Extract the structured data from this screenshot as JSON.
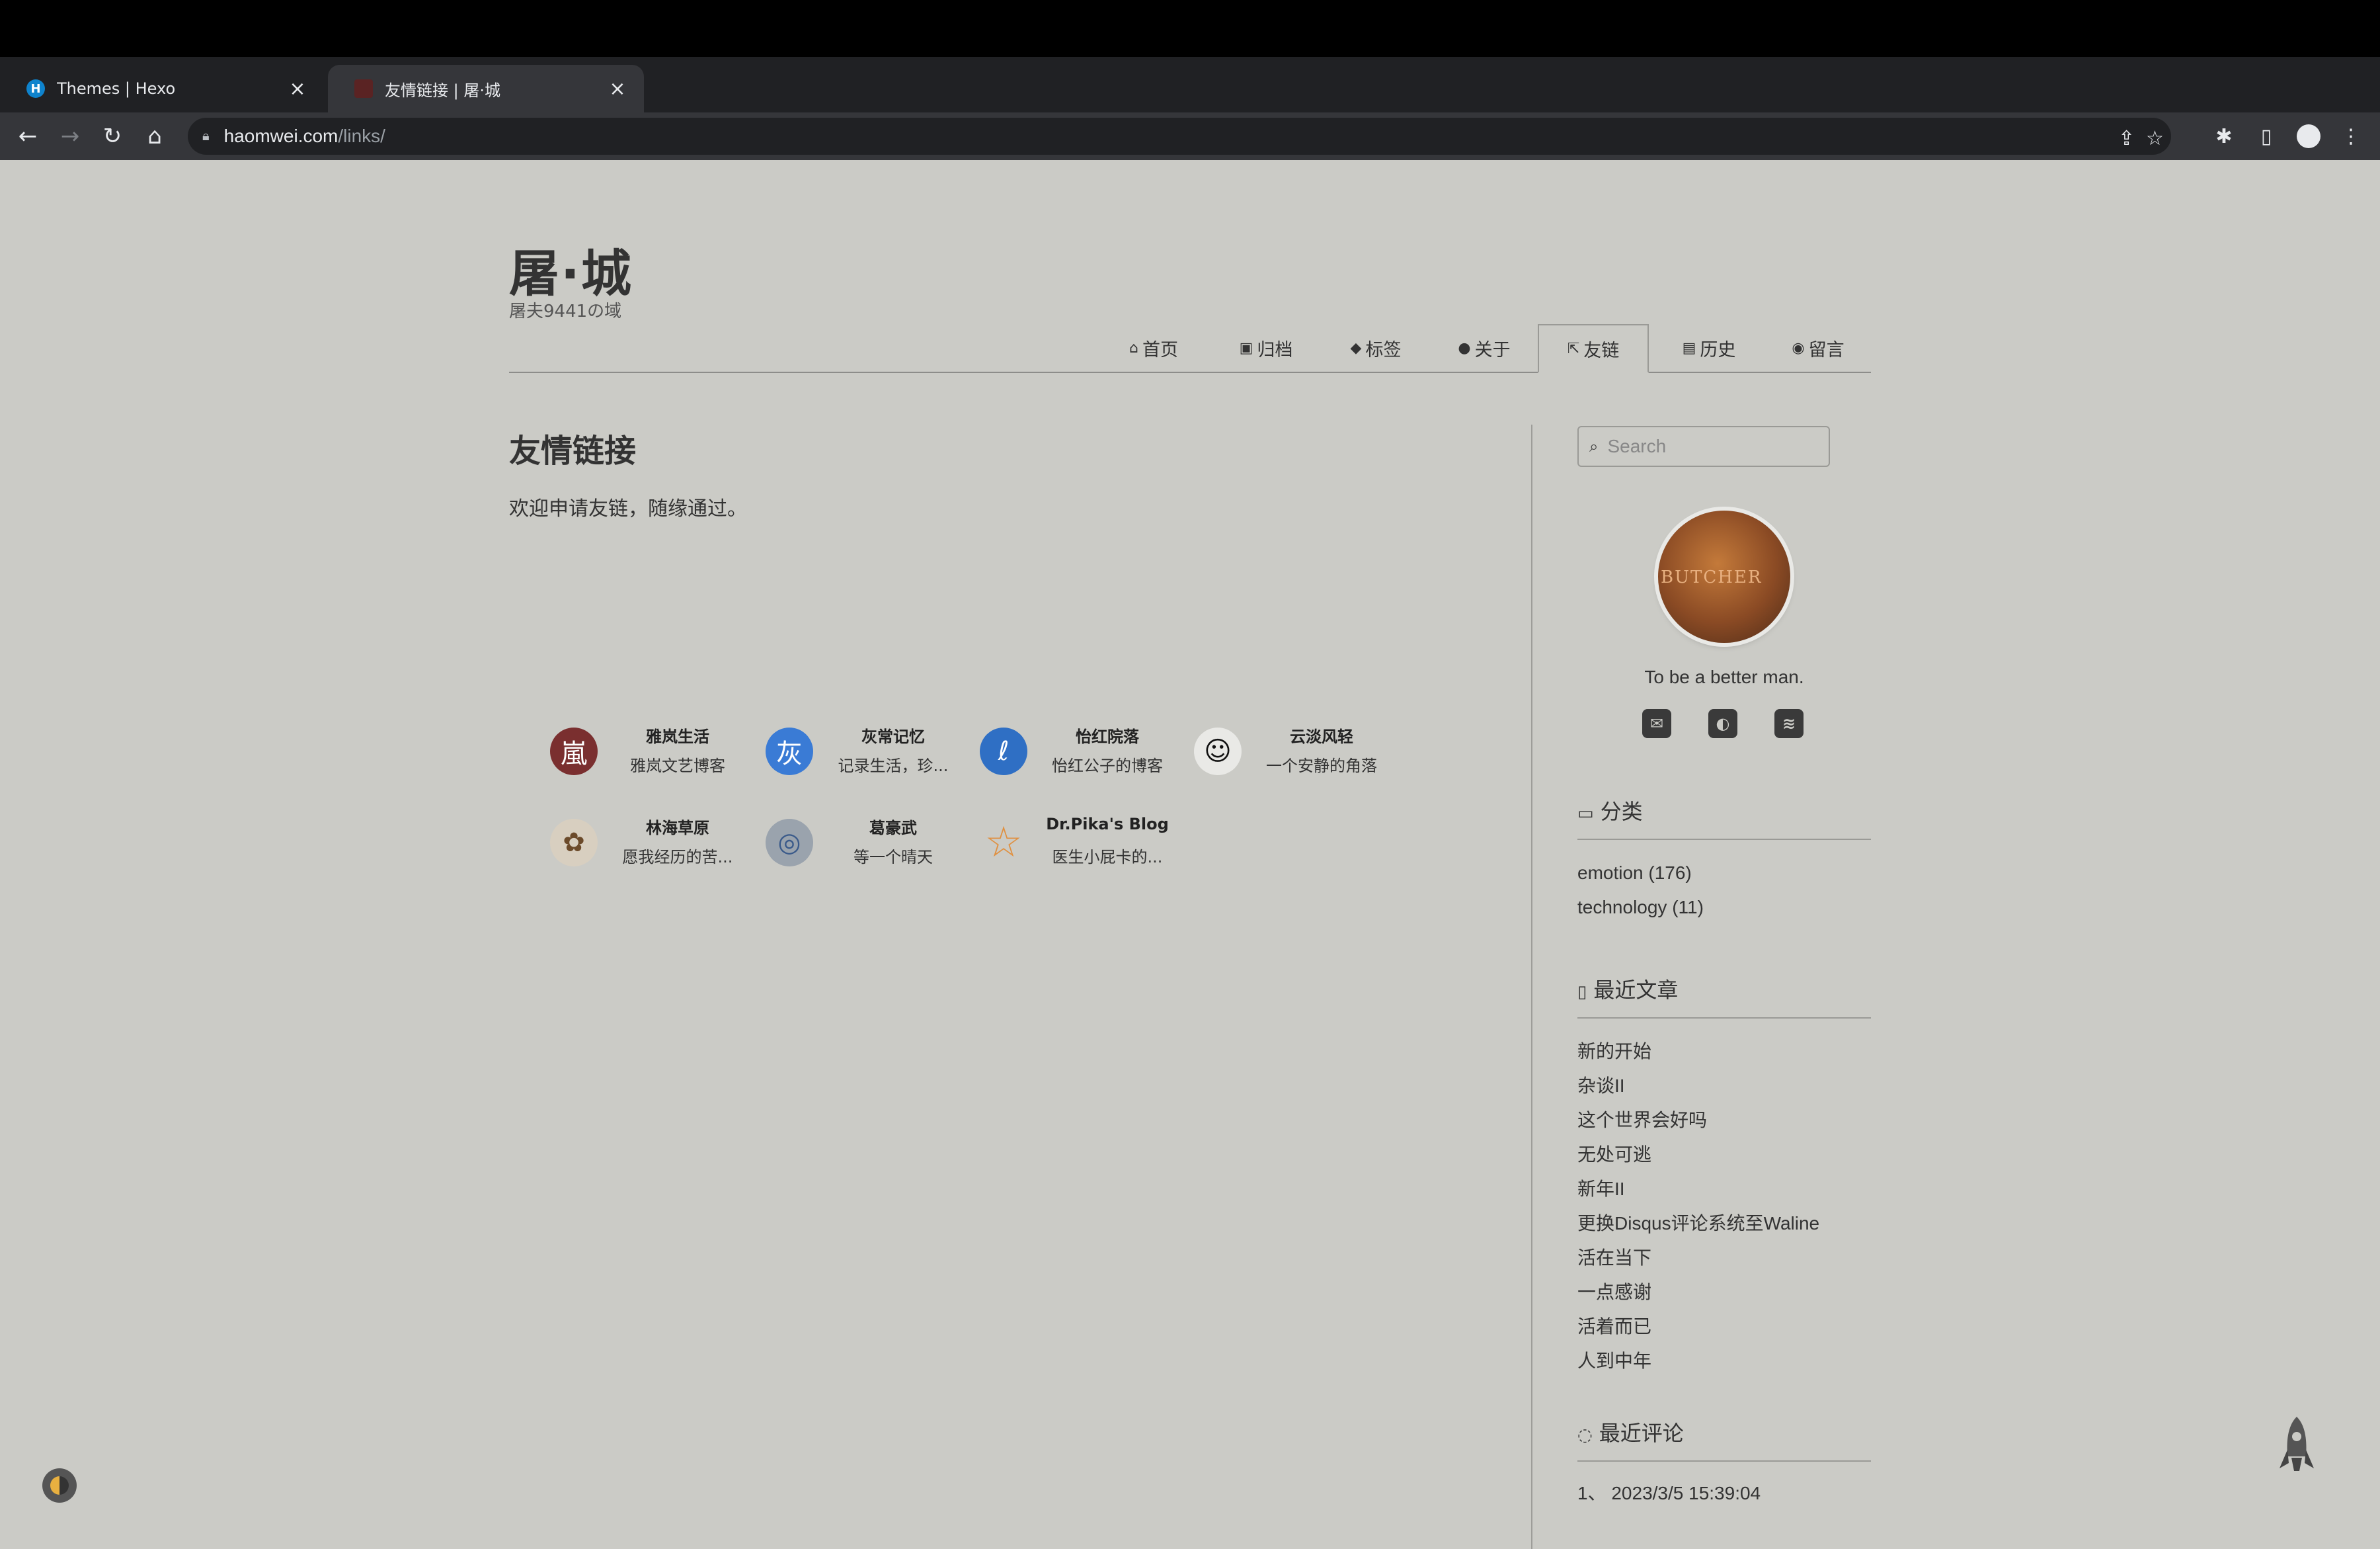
{
  "browser": {
    "tabs": [
      {
        "favicon": "H",
        "title": "Themes | Hexo",
        "close": "×"
      },
      {
        "favicon": "",
        "title": "友情链接 | 屠·城",
        "close": "×"
      }
    ],
    "new_tab": "+",
    "tab_menu": "⌄",
    "back": "←",
    "forward": "→",
    "reload": "↻",
    "home": "⌂",
    "url_domain": "haomwei.com",
    "url_path": "/links/",
    "share": "⇪",
    "bookmark": "☆",
    "extensions": "✱",
    "sidepanel": "▯",
    "menu": "⋮"
  },
  "site": {
    "title": "屠·城",
    "subtitle": "屠夫9441の域"
  },
  "nav": [
    {
      "icon": "⌂",
      "label": "首页"
    },
    {
      "icon": "▣",
      "label": "归档"
    },
    {
      "icon": "◆",
      "label": "标签"
    },
    {
      "icon": "●",
      "label": "关于"
    },
    {
      "icon": "⇱",
      "label": "友链"
    },
    {
      "icon": "▤",
      "label": "历史"
    },
    {
      "icon": "◉",
      "label": "留言"
    }
  ],
  "main": {
    "title": "友情链接",
    "intro": "欢迎申请友链，随缘通过。",
    "links": [
      {
        "name": "雅岚生活",
        "desc": "雅岚文艺博客",
        "avatar_char": "嵐",
        "avatar_color": "#7a2f2f"
      },
      {
        "name": "灰常记忆",
        "desc": "记录生活，珍...",
        "avatar_char": "灰",
        "avatar_color": "#3a7bd5"
      },
      {
        "name": "怡红院落",
        "desc": "怡红公子的博客",
        "avatar_char": "ℓ",
        "avatar_color": "#2f6fc4"
      },
      {
        "name": "云淡风轻",
        "desc": "一个安静的角落",
        "avatar_char": "☺",
        "avatar_color": "#e9e9e6"
      },
      {
        "name": "林海草原",
        "desc": "愿我经历的苦...",
        "avatar_char": "✿",
        "avatar_color": "#d8cfc0"
      },
      {
        "name": "葛豪武",
        "desc": "等一个晴天",
        "avatar_char": "◎",
        "avatar_color": "#9aa3ad"
      },
      {
        "name": "Dr.Pika's Blog",
        "desc": "医生小屁卡的...",
        "avatar_char": "☆",
        "avatar_color": "#cbcbc6"
      }
    ]
  },
  "sidebar": {
    "search_placeholder": "Search",
    "avatar_text": "BUTCHER",
    "motto": "To be a better man.",
    "social": [
      {
        "icon": "mail-icon",
        "glyph": "✉"
      },
      {
        "icon": "github-icon",
        "glyph": "◐"
      },
      {
        "icon": "rss-icon",
        "glyph": "≋"
      }
    ],
    "categories_title": "分类",
    "categories": [
      "emotion (176)",
      "technology (11)"
    ],
    "recent_title": "最近文章",
    "recent_posts": [
      "新的开始",
      "杂谈II",
      "这个世界会好吗",
      "无处可逃",
      "新年II",
      "更换Disqus评论系统至Waline",
      "活在当下",
      "一点感谢",
      "活着而已",
      "人到中年"
    ],
    "comments_title": "最近评论",
    "comments": [
      "1、 2023/3/5 15:39:04"
    ]
  },
  "colors": {
    "page_bg": "#cbcbc6",
    "text": "#333333",
    "chrome_dark": "#202124",
    "chrome_tab": "#35363a"
  }
}
